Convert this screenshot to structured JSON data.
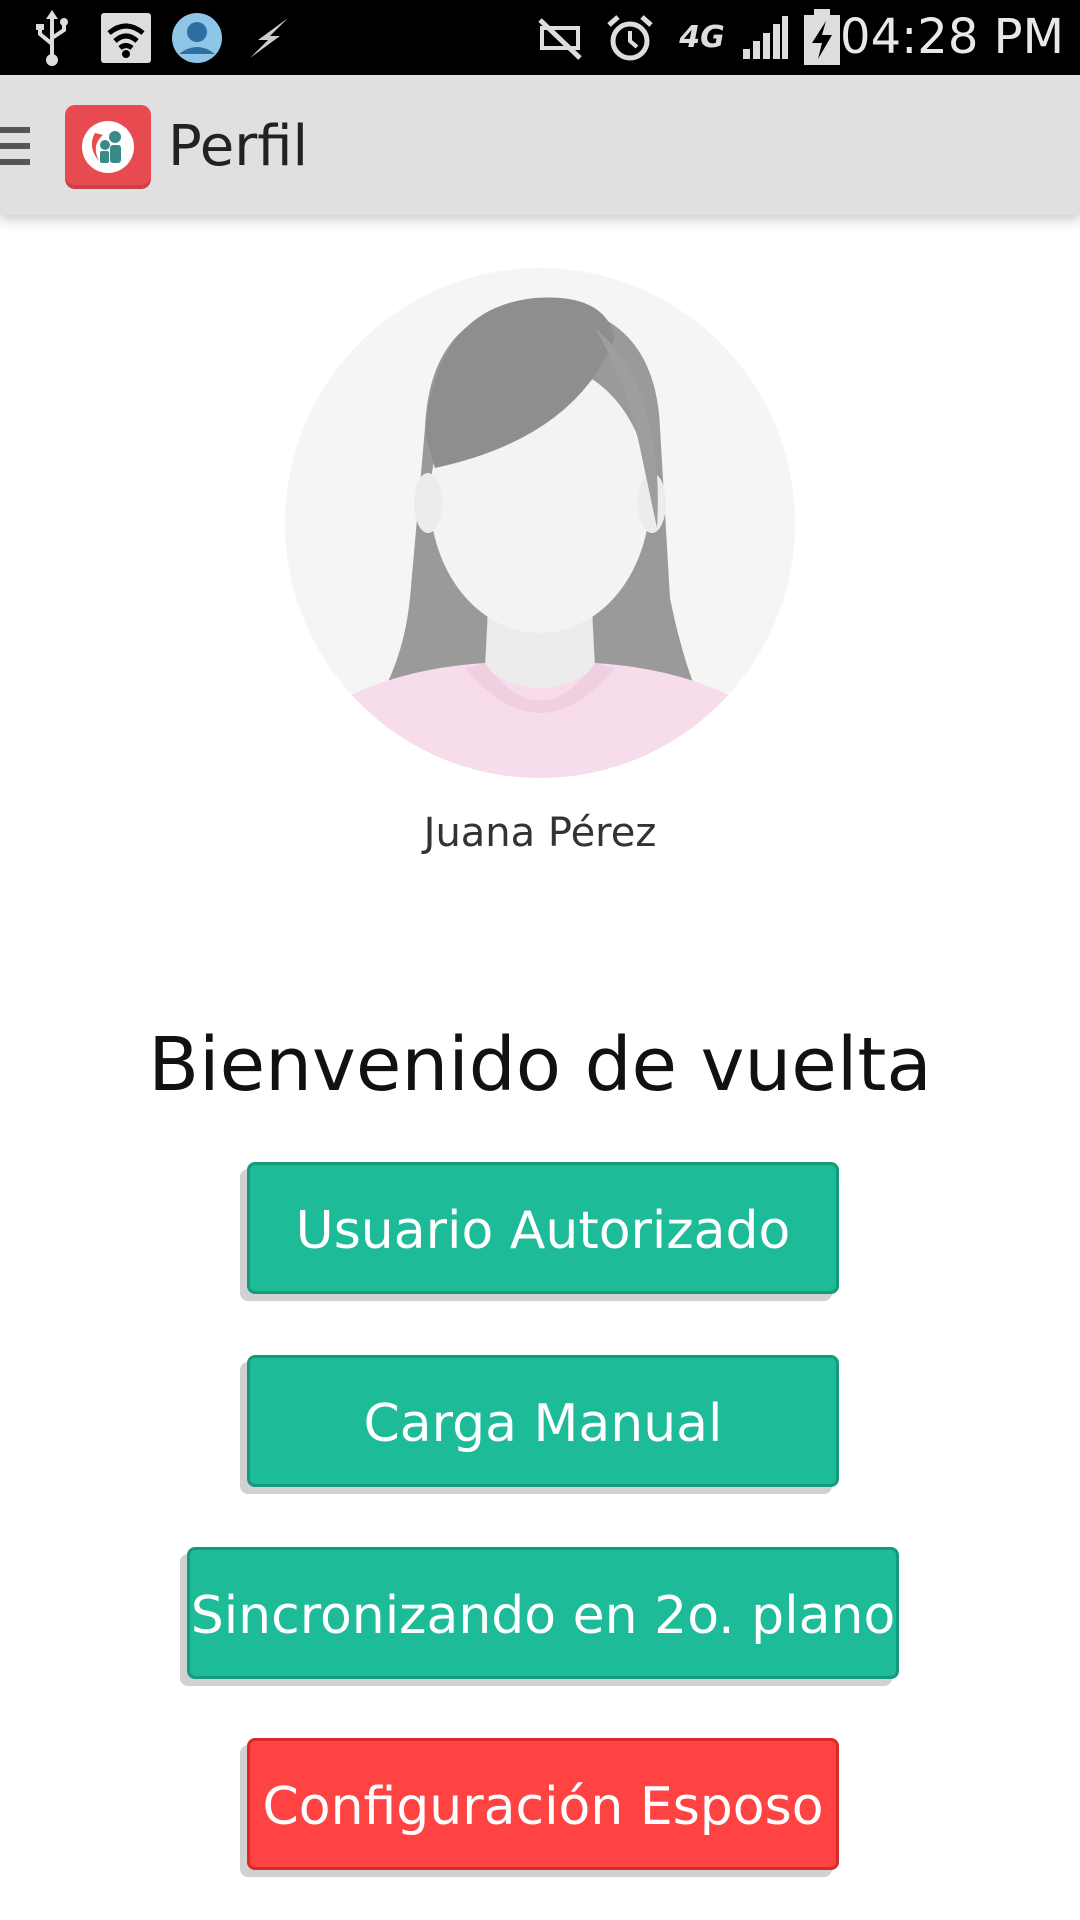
{
  "status_bar": {
    "time": "04:28 PM",
    "network_label": "4G"
  },
  "app_bar": {
    "title": "Perfil"
  },
  "profile": {
    "name": "Juana Pérez"
  },
  "welcome_text": "Bienvenido de vuelta",
  "buttons": {
    "authorized_user": "Usuario Autorizado",
    "manual_load": "Carga Manual",
    "background_sync": "Sincronizando en 2o. plano",
    "spouse_config": "Configuración Esposo"
  },
  "colors": {
    "primary_button": "#1dbb98",
    "danger_button": "#ff4343",
    "app_bar": "#e0e0e0",
    "status_bar": "#000000"
  }
}
